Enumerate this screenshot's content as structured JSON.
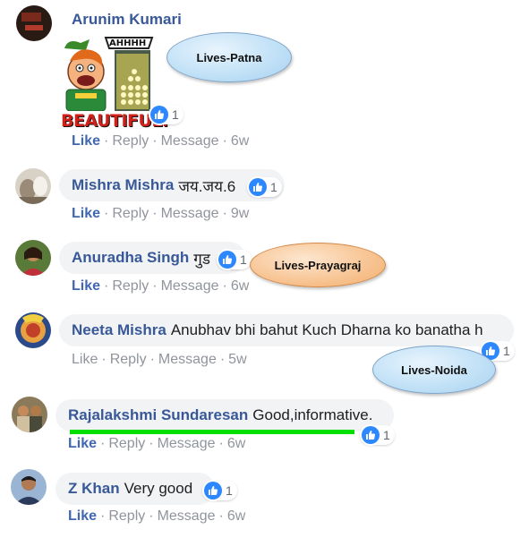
{
  "comments": [
    {
      "name": "Arunim Kumari",
      "text": "",
      "reactions": "1",
      "actions": {
        "like": "Like",
        "reply": "Reply",
        "message": "Message",
        "time": "6w"
      },
      "sticker": {
        "top_text": "AHHHH",
        "bottom_text": "BEAUTIFUL."
      }
    },
    {
      "name": "Mishra Mishra",
      "text": "जय.जय.6",
      "reactions": "1",
      "actions": {
        "like": "Like",
        "reply": "Reply",
        "message": "Message",
        "time": "9w"
      }
    },
    {
      "name": "Anuradha Singh",
      "text": "गुड",
      "reactions": "1",
      "actions": {
        "like": "Like",
        "reply": "Reply",
        "message": "Message",
        "time": "6w"
      }
    },
    {
      "name": "Neeta Mishra",
      "text": "Anubhav bhi bahut Kuch Dharna ko banatha h",
      "reactions": "1",
      "actions": {
        "like": "Like",
        "reply": "Reply",
        "message": "Message",
        "time": "5w"
      }
    },
    {
      "name": "Rajalakshmi Sundaresan",
      "text": "Good,informative.",
      "reactions": "1",
      "actions": {
        "like": "Like",
        "reply": "Reply",
        "message": "Message",
        "time": "6w"
      }
    },
    {
      "name": "Z Khan",
      "text": "Very good",
      "reactions": "1",
      "actions": {
        "like": "Like",
        "reply": "Reply",
        "message": "Message",
        "time": "6w"
      }
    }
  ],
  "callouts": {
    "patna": "Lives-Patna",
    "prayagraj": "Lives-Prayagraj",
    "noida": "Lives-Noida"
  },
  "colors": {
    "name": "#385898",
    "like_action": "#4267b2",
    "bubble": "#f2f3f5",
    "like_icon": "#2d88ff",
    "highlight": "#00e000"
  }
}
